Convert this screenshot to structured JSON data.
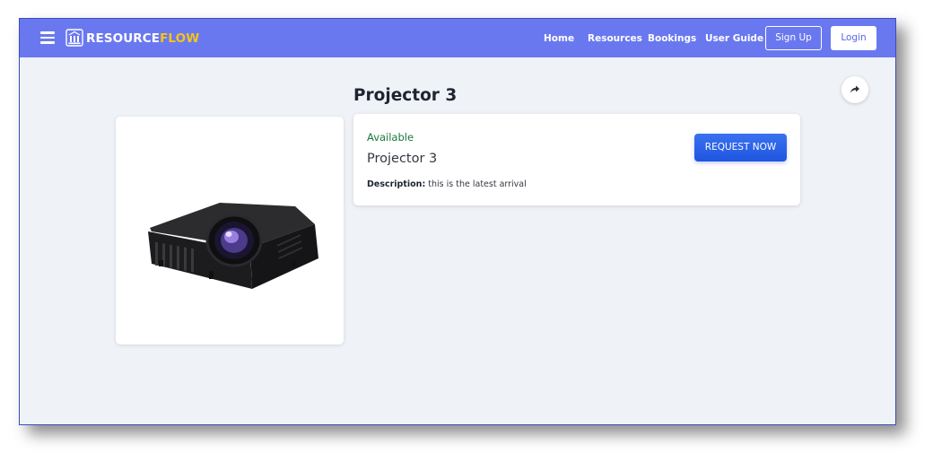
{
  "app": {
    "brand_part1": "RESOURCE",
    "brand_part2": "FLOW",
    "accent_color": "#6a78f0",
    "brand_highlight_color": "#f5c518"
  },
  "navbar": {
    "links": [
      {
        "label": "Home"
      },
      {
        "label": "Resources"
      },
      {
        "label": "Bookings"
      },
      {
        "label": "User Guide"
      }
    ],
    "signup_label": "Sign Up",
    "login_label": "Login",
    "icons": [
      "menu-icon",
      "resourceflow-logo-icon"
    ]
  },
  "page": {
    "title": "Projector 3",
    "share_icon": "share-icon"
  },
  "resource": {
    "status": "Available",
    "status_color": "#1a7a3c",
    "name": "Projector 3",
    "description_label": "Description:",
    "description": "this is the latest arrival",
    "image": "projector-image",
    "request_button_label": "REQUEST NOW"
  }
}
